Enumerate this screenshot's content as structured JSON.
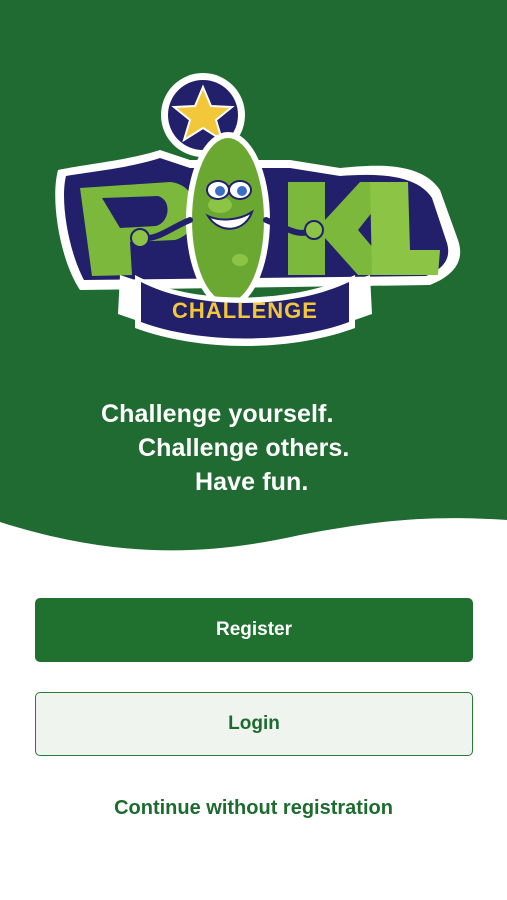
{
  "logo": {
    "main_text": "PKL",
    "banner_text": "CHALLENGE"
  },
  "tagline": {
    "line1": "Challenge yourself.",
    "line2": "Challenge others.",
    "line3": "Have fun."
  },
  "actions": {
    "register_label": "Register",
    "login_label": "Login",
    "continue_label": "Continue without registration"
  },
  "colors": {
    "brand_green": "#1f6b31",
    "button_green": "#20702f",
    "login_bg": "#eff4ef",
    "star": "#f3c73a",
    "logo_outline": "#23206b"
  }
}
